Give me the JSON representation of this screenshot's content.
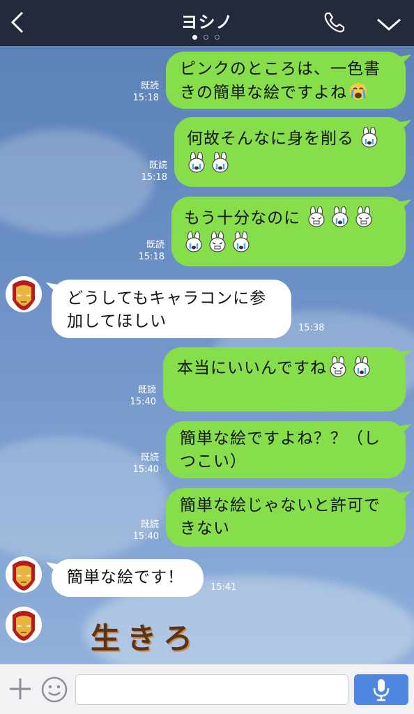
{
  "header": {
    "title": "ヨシノ",
    "back_icon": "chevron-left-icon",
    "call_icon": "phone-icon",
    "menu_icon": "chevron-down-icon",
    "page_dots": 3,
    "active_dot": 0
  },
  "messages": [
    {
      "side": "out",
      "text": [
        "ピンクのところは、一色書",
        "きの簡単な絵ですよね"
      ],
      "read": "既読",
      "time": "15:18"
    },
    {
      "side": "out",
      "text": [
        "何故そんなに身を削る",
        ""
      ],
      "read": "既読",
      "time": "15:18"
    },
    {
      "side": "out",
      "text": [
        "もう十分なのに",
        ""
      ],
      "read": "既読",
      "time": "15:18"
    },
    {
      "side": "in",
      "text": [
        "どうしてもキャラコンに参",
        "加してほしい"
      ],
      "time": "15:38"
    },
    {
      "side": "out",
      "text": [
        "本当にいいんですね"
      ],
      "read": "既読",
      "time": "15:40"
    },
    {
      "side": "out",
      "text": [
        "簡単な絵ですよね？？（し",
        "つこい）"
      ],
      "read": "既読",
      "time": "15:40"
    },
    {
      "side": "out",
      "text": [
        "簡単な絵じゃないと許可で",
        "きない"
      ],
      "read": "既読",
      "time": "15:40"
    },
    {
      "side": "in",
      "text": [
        "簡単な絵です！"
      ],
      "time": "15:41"
    }
  ],
  "sticker_text": "生きろ",
  "footer": {
    "plus_icon": "plus-icon",
    "emoji_icon": "smiley-icon",
    "input_value": "",
    "input_placeholder": "",
    "mic_icon": "microphone-icon"
  },
  "colors": {
    "header_bg": "#232a3c",
    "outgoing_bubble": "#86de4a",
    "incoming_bubble": "#ffffff",
    "send_button": "#4e86e0"
  }
}
